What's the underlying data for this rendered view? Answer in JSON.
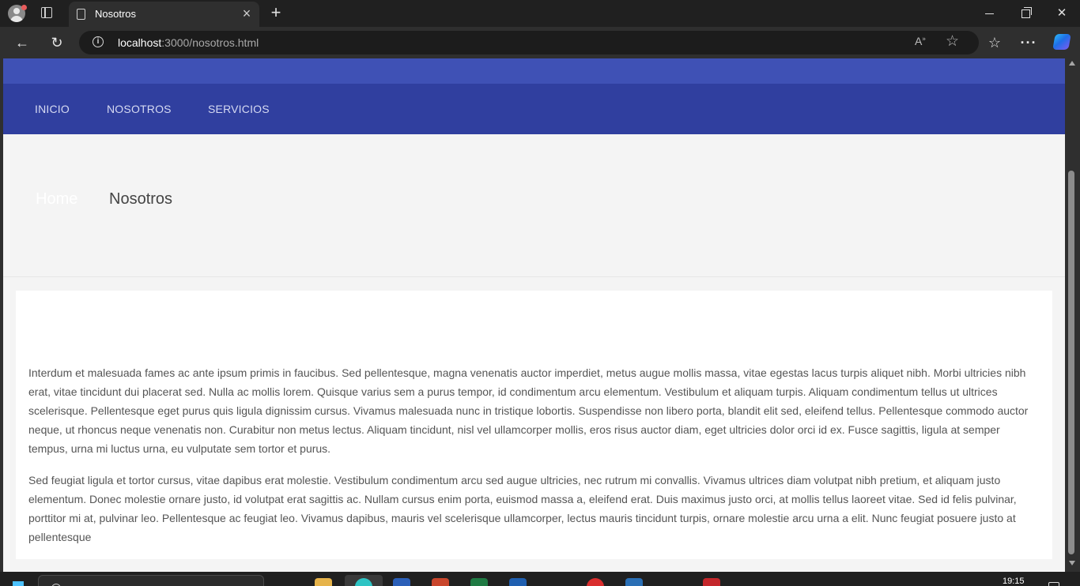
{
  "browser": {
    "tab": {
      "title": "Nosotros"
    },
    "address": {
      "host": "localhost",
      "path": ":3000/nosotros.html"
    },
    "colors": {
      "frame": "#202020",
      "toolbar": "#2f2f2f"
    }
  },
  "site": {
    "nav": {
      "items": [
        {
          "label": "INICIO"
        },
        {
          "label": "NOSOTROS"
        },
        {
          "label": "SERVICIOS"
        }
      ]
    },
    "breadcrumb": {
      "home": "Home",
      "current": "Nosotros"
    },
    "content": {
      "paragraphs": [
        "Interdum et malesuada fames ac ante ipsum primis in faucibus. Sed pellentesque, magna venenatis auctor imperdiet, metus augue mollis massa, vitae egestas lacus turpis aliquet nibh. Morbi ultricies nibh erat, vitae tincidunt dui placerat sed. Nulla ac mollis lorem. Quisque varius sem a purus tempor, id condimentum arcu elementum. Vestibulum et aliquam turpis. Aliquam condimentum tellus ut ultrices scelerisque. Pellentesque eget purus quis ligula dignissim cursus. Vivamus malesuada nunc in tristique lobortis. Suspendisse non libero porta, blandit elit sed, eleifend tellus. Pellentesque commodo auctor neque, ut rhoncus neque venenatis non. Curabitur non metus lectus. Aliquam tincidunt, nisl vel ullamcorper mollis, eros risus auctor diam, eget ultricies dolor orci id ex. Fusce sagittis, ligula at semper tempus, urna mi luctus urna, eu vulputate sem tortor et purus.",
        "Sed feugiat ligula et tortor cursus, vitae dapibus erat molestie. Vestibulum condimentum arcu sed augue ultricies, nec rutrum mi convallis. Vivamus ultrices diam volutpat nibh pretium, et aliquam justo elementum. Donec molestie ornare justo, id volutpat erat sagittis ac. Nullam cursus enim porta, euismod massa a, eleifend erat. Duis maximus justo orci, at mollis tellus laoreet vitae. Sed id felis pulvinar, porttitor mi at, pulvinar leo. Pellentesque ac feugiat leo. Vivamus dapibus, mauris vel scelerisque ullamcorper, lectus mauris tincidunt turpis, ornare molestie arcu urna a elit. Nunc feugiat posuere justo at pellentesque"
      ]
    },
    "colors": {
      "top_strip": "#3f51b5",
      "navbar": "#303f9f",
      "hero_bg": "#f4f4f4"
    }
  },
  "taskbar": {
    "time": "19:15"
  }
}
